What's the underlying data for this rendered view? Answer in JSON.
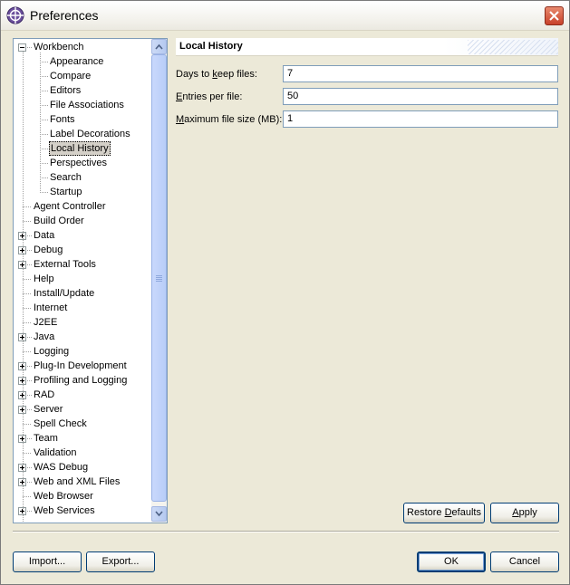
{
  "window": {
    "title": "Preferences"
  },
  "tree": {
    "items": [
      {
        "label": "Workbench",
        "level": 0,
        "expander": "minus"
      },
      {
        "label": "Appearance",
        "level": 1
      },
      {
        "label": "Compare",
        "level": 1
      },
      {
        "label": "Editors",
        "level": 1
      },
      {
        "label": "File Associations",
        "level": 1
      },
      {
        "label": "Fonts",
        "level": 1
      },
      {
        "label": "Label Decorations",
        "level": 1
      },
      {
        "label": "Local History",
        "level": 1,
        "selected": true
      },
      {
        "label": "Perspectives",
        "level": 1
      },
      {
        "label": "Search",
        "level": 1
      },
      {
        "label": "Startup",
        "level": 1
      },
      {
        "label": "Agent Controller",
        "level": 0
      },
      {
        "label": "Build Order",
        "level": 0
      },
      {
        "label": "Data",
        "level": 0,
        "expander": "plus"
      },
      {
        "label": "Debug",
        "level": 0,
        "expander": "plus"
      },
      {
        "label": "External Tools",
        "level": 0,
        "expander": "plus"
      },
      {
        "label": "Help",
        "level": 0
      },
      {
        "label": "Install/Update",
        "level": 0
      },
      {
        "label": "Internet",
        "level": 0
      },
      {
        "label": "J2EE",
        "level": 0
      },
      {
        "label": "Java",
        "level": 0,
        "expander": "plus"
      },
      {
        "label": "Logging",
        "level": 0
      },
      {
        "label": "Plug-In Development",
        "level": 0,
        "expander": "plus"
      },
      {
        "label": "Profiling and Logging",
        "level": 0,
        "expander": "plus"
      },
      {
        "label": "RAD",
        "level": 0,
        "expander": "plus"
      },
      {
        "label": "Server",
        "level": 0,
        "expander": "plus"
      },
      {
        "label": "Spell Check",
        "level": 0
      },
      {
        "label": "Team",
        "level": 0,
        "expander": "plus"
      },
      {
        "label": "Validation",
        "level": 0
      },
      {
        "label": "WAS Debug",
        "level": 0,
        "expander": "plus"
      },
      {
        "label": "Web and XML Files",
        "level": 0,
        "expander": "plus"
      },
      {
        "label": "Web Browser",
        "level": 0
      },
      {
        "label": "Web Services",
        "level": 0,
        "expander": "plus"
      }
    ]
  },
  "page": {
    "title": "Local History",
    "fields": [
      {
        "label_pre": "Days to ",
        "label_u": "k",
        "label_post": "eep files:",
        "value": "7"
      },
      {
        "label_pre": "",
        "label_u": "E",
        "label_post": "ntries per file:",
        "value": "50"
      },
      {
        "label_pre": "",
        "label_u": "M",
        "label_post": "aximum file size (MB):",
        "value": "1"
      }
    ],
    "restore_pre": "Restore ",
    "restore_u": "D",
    "restore_post": "efaults",
    "apply_u": "A",
    "apply_post": "pply"
  },
  "footer": {
    "import_label": "Import...",
    "export_label": "Export...",
    "ok_label": "OK",
    "cancel_label": "Cancel"
  },
  "colors": {
    "dialog_bg": "#ece9d8",
    "selection_bg": "#d4d0c8",
    "field_border": "#7f9db9"
  }
}
